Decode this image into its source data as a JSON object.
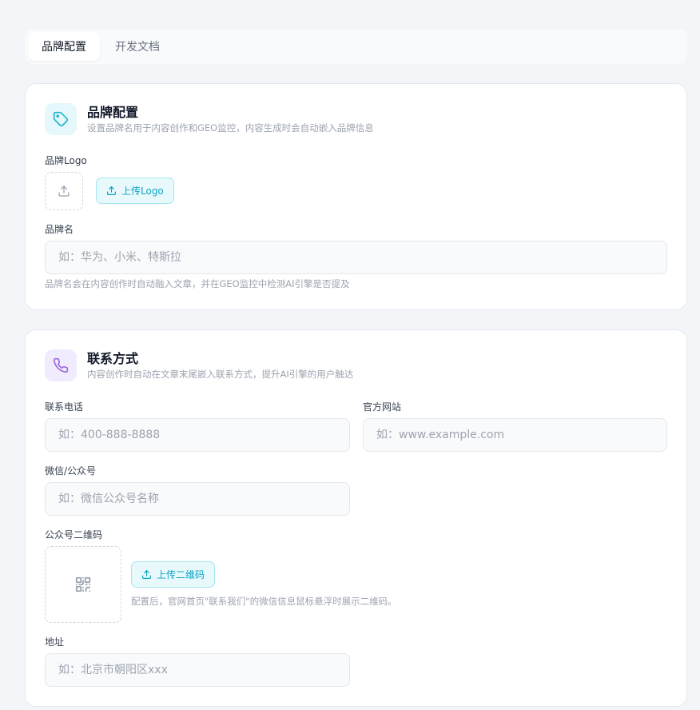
{
  "tabs": [
    {
      "label": "品牌配置",
      "active": true
    },
    {
      "label": "开发文档",
      "active": false
    }
  ],
  "brand": {
    "title": "品牌配置",
    "subtitle": "设置品牌名用于内容创作和GEO监控，内容生成时会自动嵌入品牌信息",
    "logo_label": "品牌Logo",
    "upload_logo_label": "上传Logo",
    "name_label": "品牌名",
    "name_placeholder": "如：华为、小米、特斯拉",
    "name_hint": "品牌名会在内容创作时自动融入文章，并在GEO监控中检测AI引擎是否提及"
  },
  "contact": {
    "title": "联系方式",
    "subtitle": "内容创作时自动在文章末尾嵌入联系方式，提升AI引擎的用户触达",
    "phone_label": "联系电话",
    "phone_placeholder": "如：400-888-8888",
    "website_label": "官方网站",
    "website_placeholder": "如：www.example.com",
    "wechat_label": "微信/公众号",
    "wechat_placeholder": "如：微信公众号名称",
    "qrcode_label": "公众号二维码",
    "upload_qrcode_label": "上传二维码",
    "qrcode_hint": "配置后，官网首页\"联系我们\"的微信信息鼠标悬浮时展示二维码。",
    "address_label": "地址",
    "address_placeholder": "如：北京市朝阳区xxx"
  },
  "colors": {
    "accent": "#0ea5c4",
    "brand_icon": "#1fb5cf",
    "contact_icon": "#9b6bdc"
  }
}
